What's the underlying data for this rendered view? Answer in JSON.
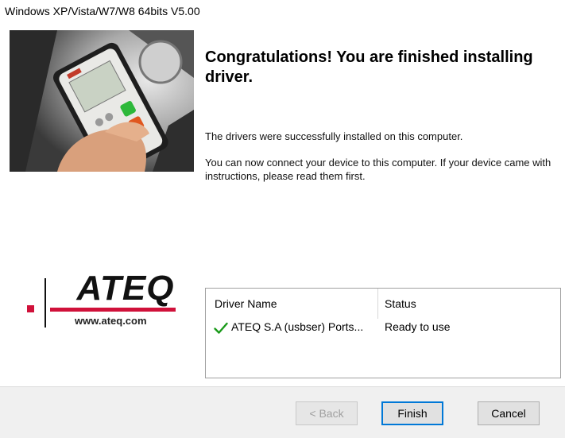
{
  "window": {
    "title": "Windows XP/Vista/W7/W8 64bits V5.00"
  },
  "banner": {
    "image": "handheld-tpms-tool-photo"
  },
  "content": {
    "heading": "Congratulations! You are finished installing driver.",
    "message1": "The drivers were successfully installed on this computer.",
    "message2": "You can now connect your device to this computer. If your device came with instructions, please read them first."
  },
  "logo": {
    "brand": "ATEQ",
    "url": "www.ateq.com",
    "accent_color": "#d0113a"
  },
  "drivers": {
    "columns": [
      "Driver Name",
      "Status"
    ],
    "rows": [
      {
        "name": "ATEQ S.A (usbser) Ports...",
        "status": "Ready to use",
        "icon": "check-icon"
      }
    ]
  },
  "buttons": {
    "back": "< Back",
    "finish": "Finish",
    "cancel": "Cancel"
  },
  "colors": {
    "focus_border": "#0078d7",
    "check": "#1a9a1a"
  }
}
